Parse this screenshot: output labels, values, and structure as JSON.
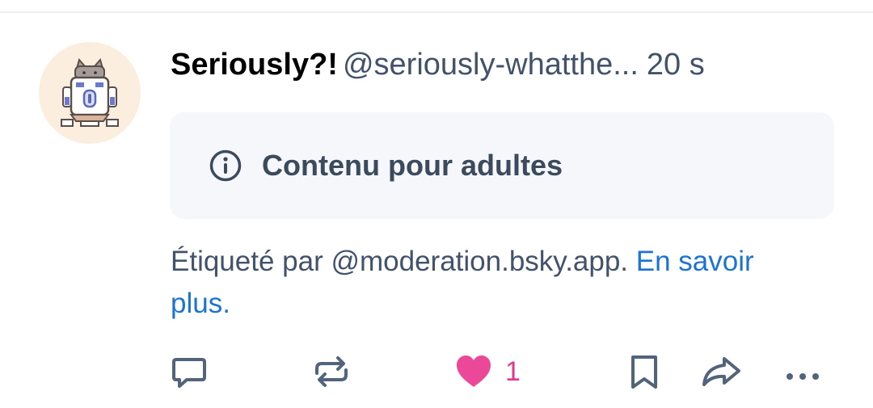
{
  "post": {
    "author": {
      "display_name": "Seriously?!",
      "handle": "@seriously-whatthe..."
    },
    "timestamp": "20 s",
    "content_warning": {
      "icon": "info-icon",
      "label": "Contenu pour adultes"
    },
    "label_note": {
      "text": "Étiqueté par @moderation.bsky.app. ",
      "link": "En savoir plus."
    },
    "actions": {
      "reply_icon": "comment-icon",
      "repost_icon": "repost-icon",
      "like_icon": "heart-icon",
      "like_count": "1",
      "bookmark_icon": "bookmark-icon",
      "share_icon": "share-icon",
      "more_icon": "more-icon"
    }
  },
  "colors": {
    "text_primary": "#000000",
    "text_secondary": "#42526b",
    "link": "#1b74d4",
    "like": "#ec4899",
    "warning_bg": "#f5f7fa"
  }
}
